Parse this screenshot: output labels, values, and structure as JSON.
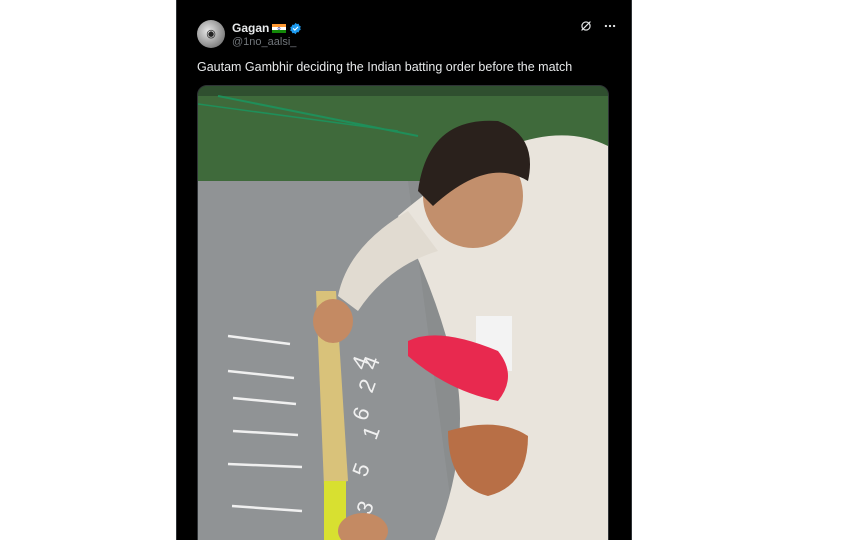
{
  "tweet": {
    "author_name": "Gagan",
    "author_handle": "@1no_aalsi_",
    "text": "Gautam Gambhir deciding the Indian batting order before the match"
  },
  "icons": {
    "flag": "india-flag-icon",
    "verified": "verified-badge-icon",
    "grok": "grok-icon",
    "more": "more-options-icon"
  },
  "media": {
    "chalk_numbers": [
      "4",
      "4",
      "2",
      "6",
      "1",
      "5",
      "3"
    ]
  },
  "colors": {
    "background": "#000000",
    "text_primary": "#e7e9ea",
    "text_secondary": "#71767b",
    "verified_blue": "#1d9bf0"
  }
}
